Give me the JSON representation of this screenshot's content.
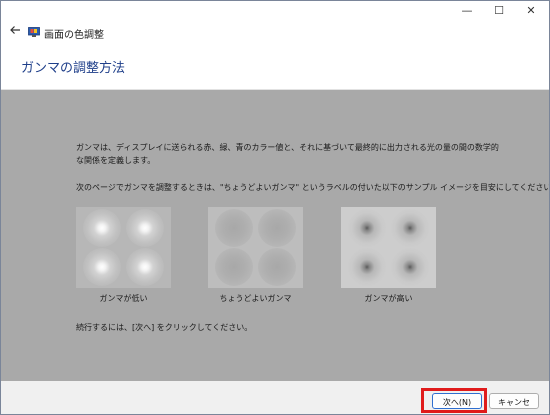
{
  "window": {
    "title": "画面の色調整",
    "controls": {
      "minimize": "—",
      "maximize": "☐",
      "close": "✕"
    }
  },
  "nav": {
    "back_icon": "arrow-left-icon"
  },
  "header": {
    "title": "ガンマの調整方法"
  },
  "content": {
    "description1": "ガンマは、ディスプレイに送られる赤、緑、青のカラー値と、それに基づいて最終的に出力される光の量の間の数学的な関係を定義します。",
    "description2": "次のページでガンマを調整するときは、\"ちょうどよいガンマ\" というラベルの付いた以下のサンプル イメージを目安にしてください。",
    "samples": [
      {
        "label": "ガンマが低い"
      },
      {
        "label": "ちょうどよいガンマ"
      },
      {
        "label": "ガンマが高い"
      }
    ],
    "instruction": "続行するには、[次へ] をクリックしてください。"
  },
  "footer": {
    "next": "次へ(N)",
    "cancel": "キャンセル"
  },
  "colors": {
    "title_blue": "#1f3f8a",
    "content_bg": "#a9a9a9",
    "highlight_red": "#e01b1b"
  }
}
